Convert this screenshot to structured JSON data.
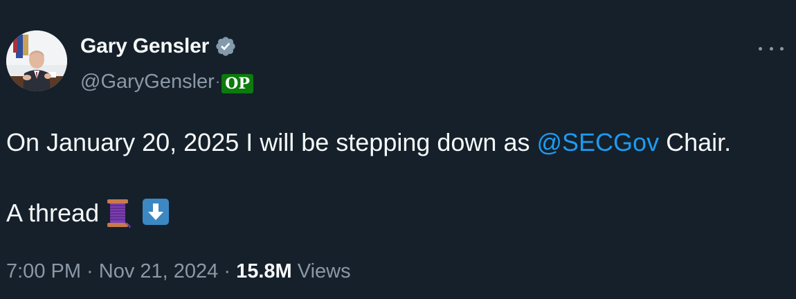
{
  "author": {
    "display_name": "Gary Gensler",
    "handle": "@GaryGensler",
    "separator": "·",
    "badge": "OP",
    "verified_icon": "verified-badge-icon",
    "avatar_icon": "profile-photo"
  },
  "menu": {
    "icon": "more-options-icon"
  },
  "tweet": {
    "line1_before": "On January 20, 2025 I will be stepping down as ",
    "mention": "@SECGov",
    "line1_after": " Chair.",
    "line2_text": "A thread",
    "emoji1": "spool-of-thread-emoji",
    "emoji2": "down-arrow-emoji"
  },
  "meta": {
    "time": "7:00 PM",
    "sep1": " · ",
    "date": "Nov 21, 2024",
    "sep2": " · ",
    "views_count": "15.8M",
    "views_label": " Views"
  },
  "colors": {
    "background": "#15202b",
    "text": "#f7f9f9",
    "secondary": "#8b98a5",
    "link": "#1d9bf0",
    "badge_bg": "#0c7a0c"
  }
}
